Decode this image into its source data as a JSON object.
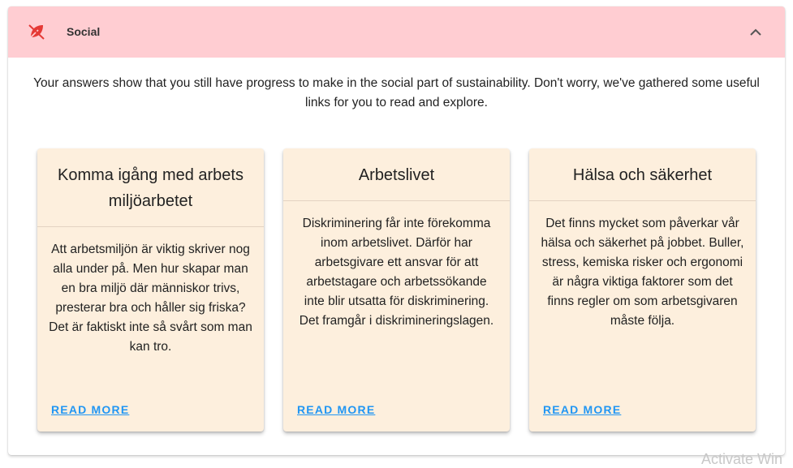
{
  "section": {
    "title": "Social",
    "icon": "crossed-leaf-icon",
    "header_color": "#ffcdd2",
    "intro": "Your answers show that you still have progress to make in the social part of sustainability. Don't worry, we've gathered some useful links for you to read and explore."
  },
  "cards": [
    {
      "title": "Komma igång med arbets miljöarbetet",
      "body": "Att arbetsmiljön är viktig skriver nog alla under på. Men hur skapar man en bra miljö där människor trivs, presterar bra och håller sig friska? Det är faktiskt inte så svårt som man kan tro.",
      "link_label": "READ MORE"
    },
    {
      "title": "Arbetslivet",
      "body": "Diskriminering får inte förekomma inom arbetslivet. Därför har arbetsgivare ett ansvar för att arbetstagare och arbetssökande inte blir utsatta för diskriminering. Det framgår i diskrimineringslagen.",
      "link_label": "READ MORE"
    },
    {
      "title": "Hälsa och säkerhet",
      "body": "Det finns mycket som påverkar vår hälsa och säkerhet på jobbet. Buller, stress, kemiska risker och ergonomi är några viktiga faktorer som det finns regler om som arbetsgivaren måste följa.",
      "link_label": "READ MORE"
    }
  ],
  "colors": {
    "card_background": "#fdefdd",
    "link": "#2196f3",
    "icon_accent": "#e53935"
  },
  "watermark": "Activate Win"
}
